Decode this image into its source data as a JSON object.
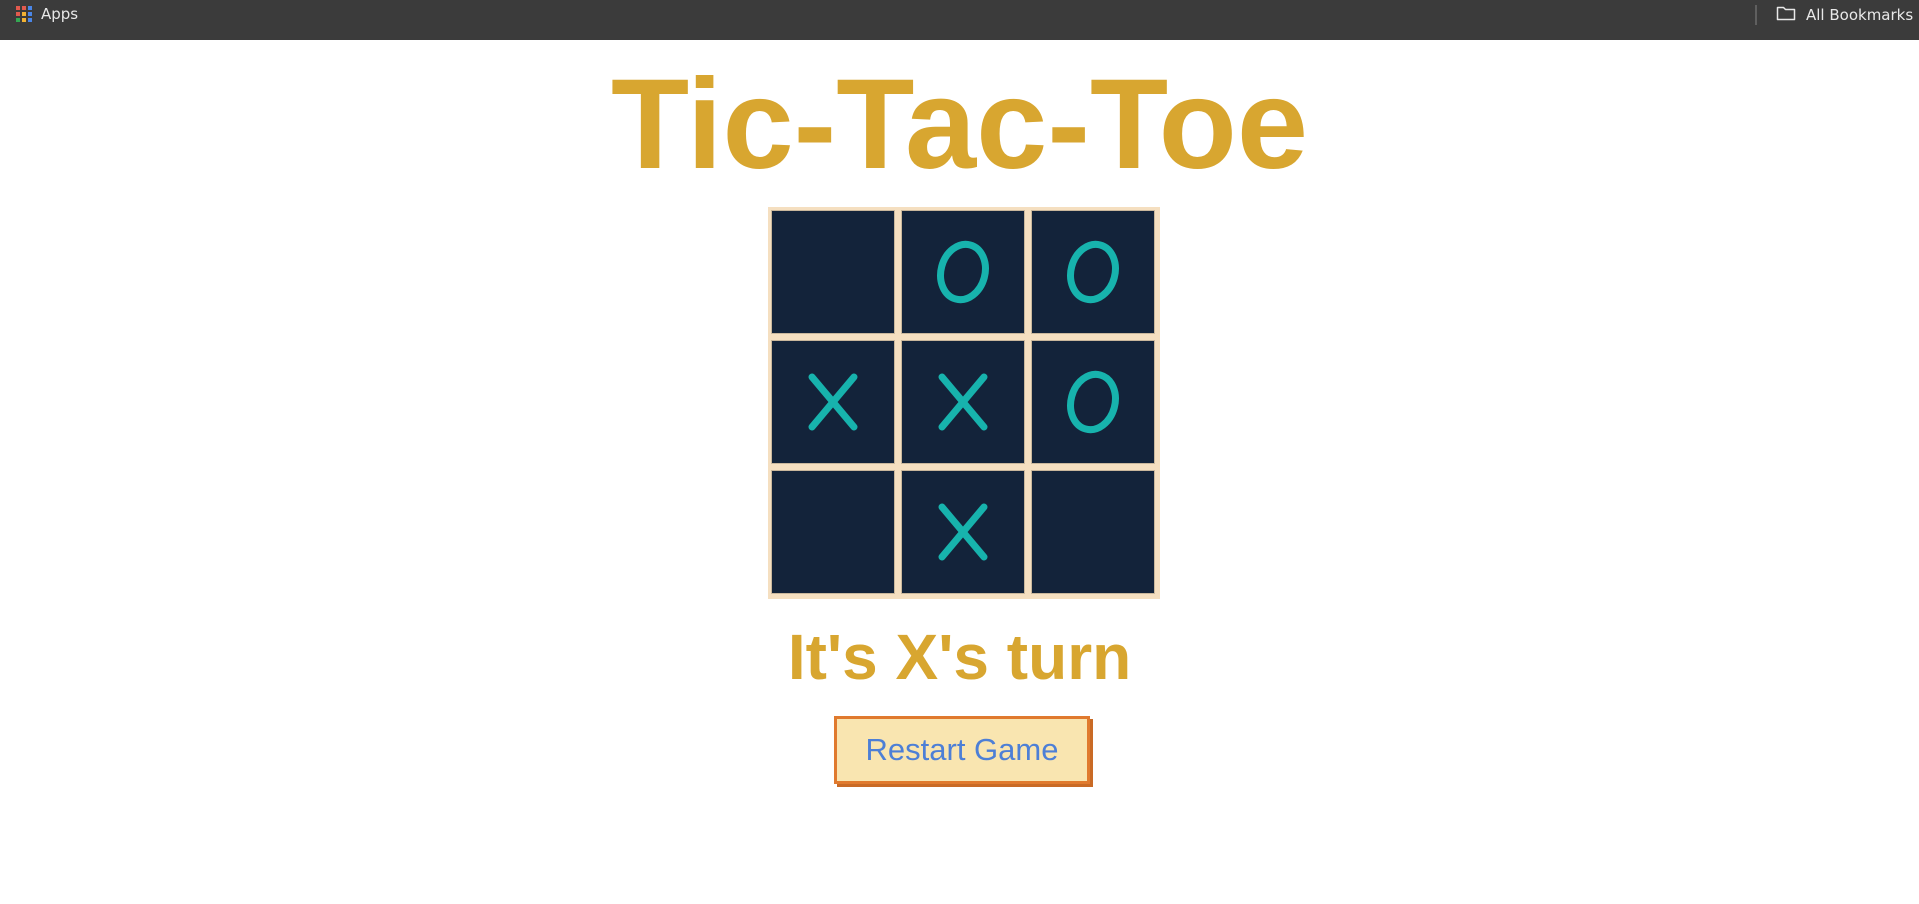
{
  "browser": {
    "apps_label": "Apps",
    "all_bookmarks_label": "All Bookmarks",
    "apps_grid_colors": [
      "#e25a4e",
      "#e25a4e",
      "#4a86e8",
      "#e25a4e",
      "#f2b233",
      "#4a86e8",
      "#34a853",
      "#f2b233",
      "#4a86e8"
    ]
  },
  "game": {
    "title": "Tic-Tac-Toe",
    "board": [
      "",
      "O",
      "O",
      "X",
      "X",
      "O",
      "",
      "X",
      ""
    ],
    "status": "It's X's turn",
    "restart_label": "Restart Game"
  },
  "colors": {
    "title": "#d8a630",
    "cell_bg": "#13233a",
    "mark": "#17b3ad",
    "board_frame": "#f5dfc0",
    "button_bg": "#f9e5b0",
    "button_border": "#e07a2e",
    "button_text": "#4d7fd6"
  }
}
